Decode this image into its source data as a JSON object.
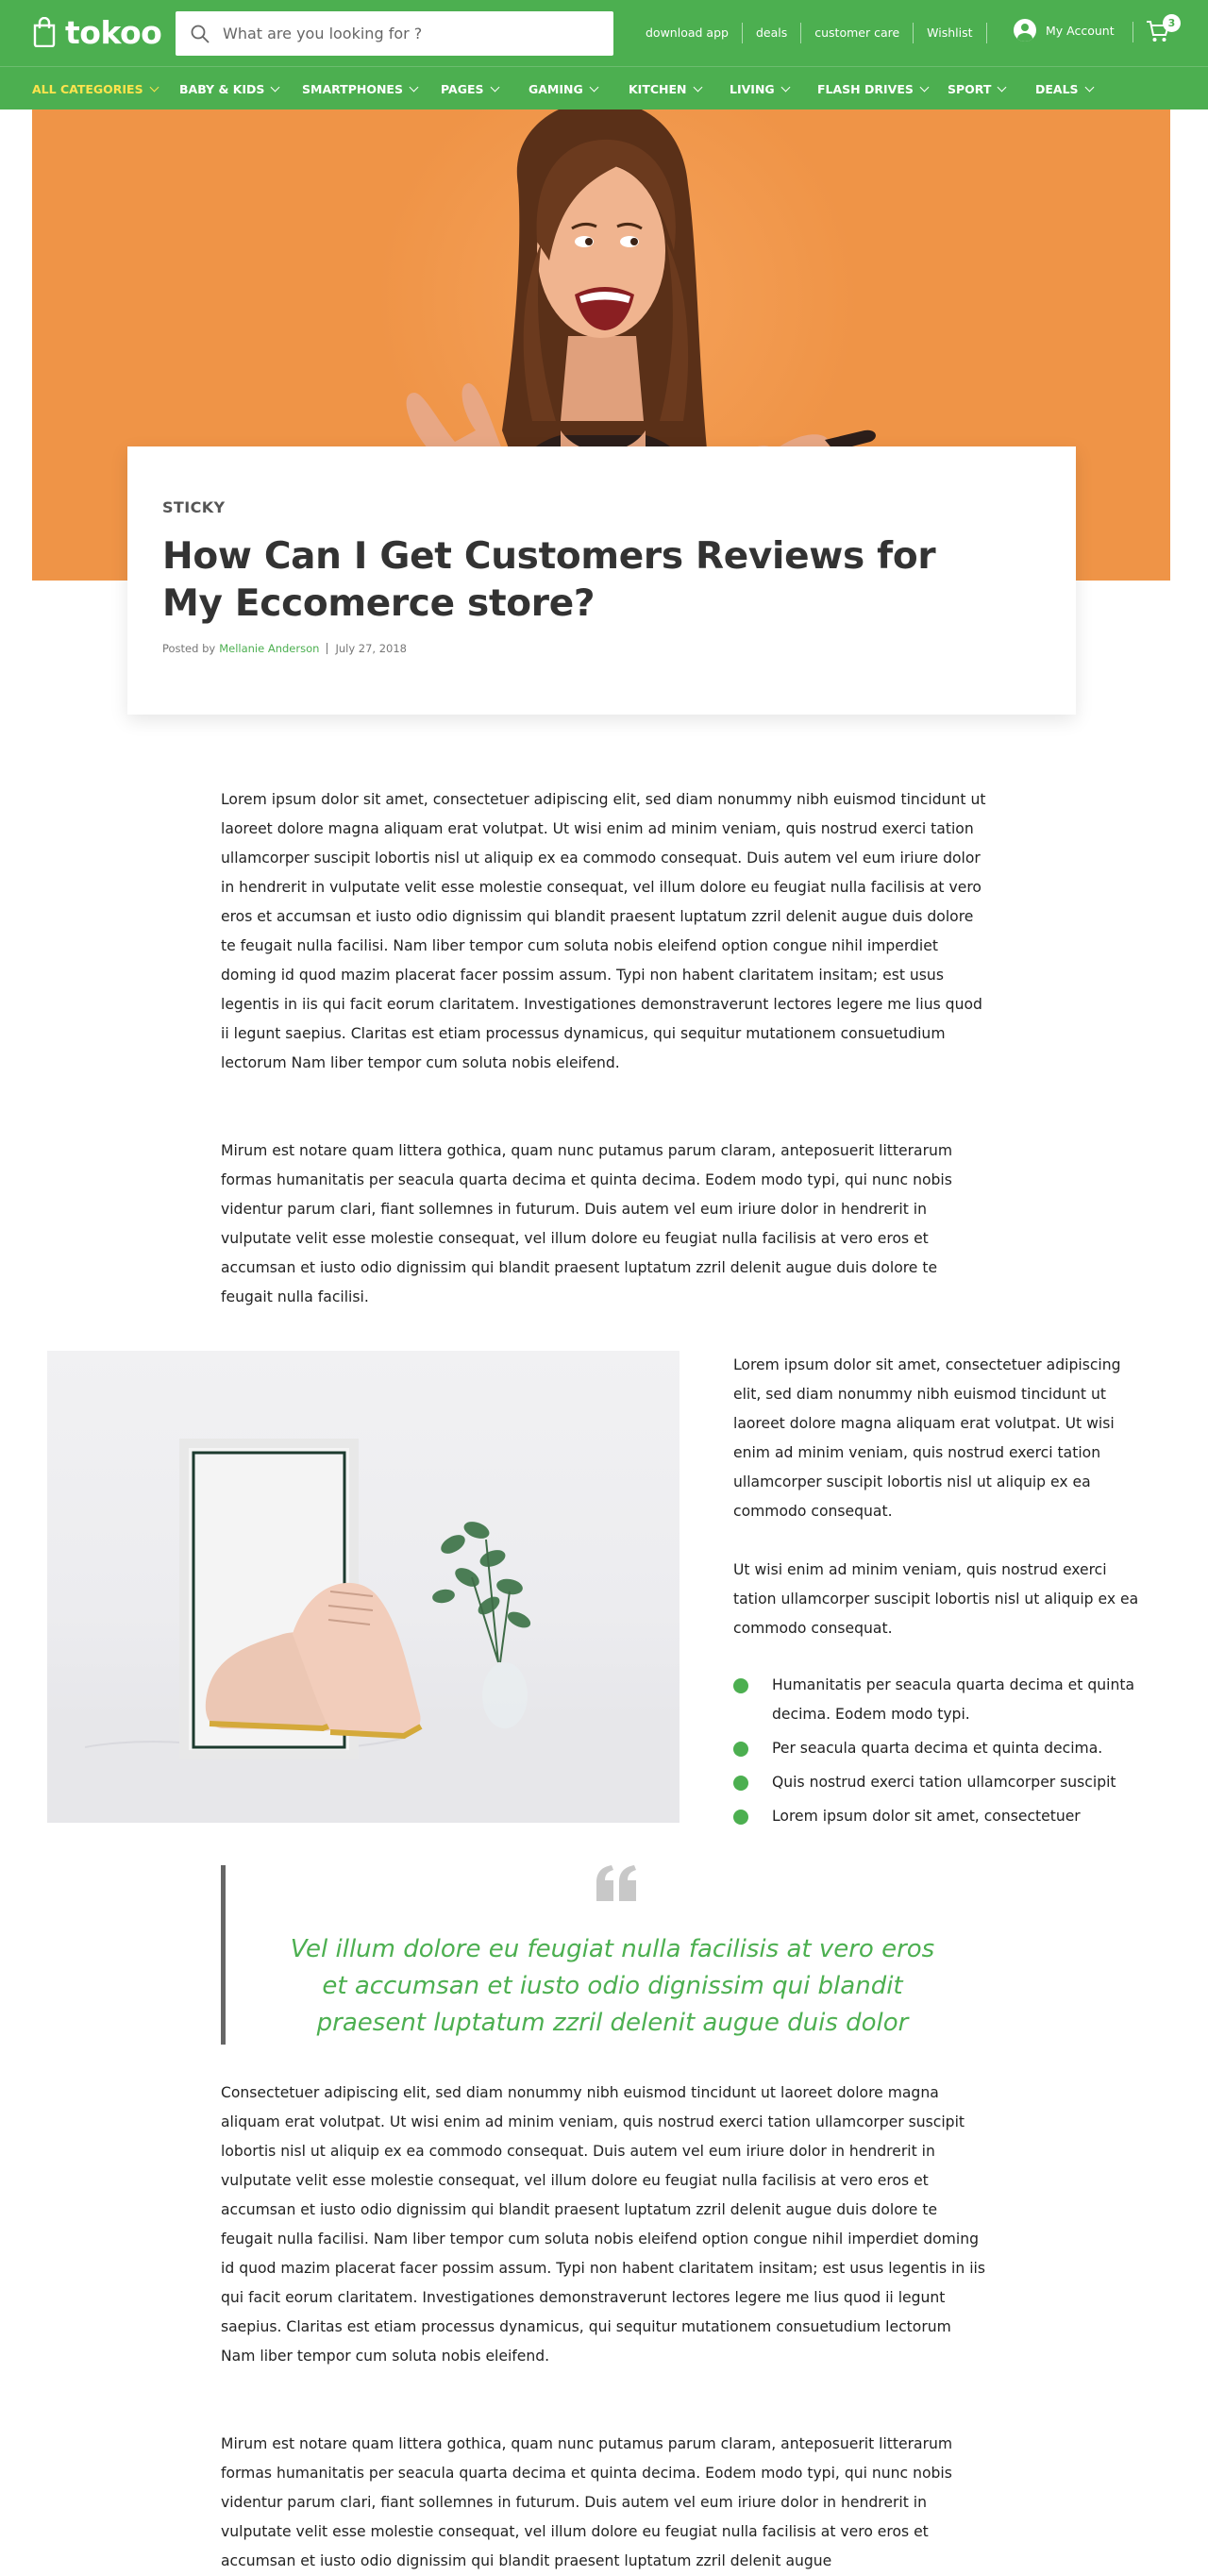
{
  "brand": {
    "name": "tokoo",
    "accent": "#4caf50",
    "nav_active": "#ffe44d",
    "hero_bg": "#ef9447"
  },
  "search": {
    "placeholder": "What are you looking for ?"
  },
  "top_links": [
    "download app",
    "deals",
    "customer care",
    "Wishlist"
  ],
  "account": {
    "label": "My Account",
    "icon": "user-icon"
  },
  "cart": {
    "count": "3",
    "icon": "cart-icon"
  },
  "nav": [
    {
      "label": "ALL CATEGORIES",
      "active": true
    },
    {
      "label": "BABY & KIDS"
    },
    {
      "label": "SMARTPHONES"
    },
    {
      "label": "PAGES"
    },
    {
      "label": "GAMING"
    },
    {
      "label": "KITCHEN"
    },
    {
      "label": "LIVING"
    },
    {
      "label": "FLASH DRIVES"
    },
    {
      "label": "SPORT"
    },
    {
      "label": "DEALS"
    }
  ],
  "post": {
    "tag": "STICKY",
    "title": "How Can I Get Customers Reviews for My Eccomerce store?",
    "posted_by": "Posted by",
    "author": "Mellanie Anderson",
    "date": "July 27, 2018"
  },
  "content": {
    "p1": "Lorem ipsum dolor sit amet, consectetuer adipiscing elit, sed diam nonummy nibh euismod tincidunt ut laoreet dolore magna aliquam erat volutpat. Ut wisi enim ad minim veniam, quis nostrud exerci tation ullamcorper suscipit lobortis nisl ut aliquip ex ea commodo consequat. Duis autem vel eum iriure dolor in hendrerit in vulputate velit esse molestie consequat, vel illum dolore eu feugiat nulla facilisis at vero eros et accumsan et iusto odio dignissim qui blandit praesent luptatum zzril delenit augue duis dolore te feugait nulla facilisi. Nam liber tempor cum soluta nobis eleifend option congue nihil imperdiet doming id quod mazim placerat facer possim assum. Typi non habent claritatem insitam; est usus legentis in iis qui facit eorum claritatem. Investigationes demonstraverunt lectores legere me lius quod ii legunt saepius. Claritas est etiam processus dynamicus, qui sequitur mutationem consuetudium lectorum Nam liber tempor cum soluta nobis eleifend.",
    "p2": "Mirum est notare quam littera gothica, quam nunc putamus parum claram, anteposuerit litterarum formas humanitatis per seacula quarta decima et quinta decima. Eodem modo typi, qui nunc nobis videntur parum clari, fiant sollemnes in futurum. Duis autem vel eum iriure dolor in hendrerit in vulputate velit esse molestie consequat, vel illum dolore eu feugiat nulla facilisis at vero eros et accumsan et iusto odio dignissim qui blandit praesent luptatum zzril delenit augue duis dolore te feugait nulla facilisi.",
    "side1": "Lorem ipsum dolor sit amet, consectetuer adipiscing elit, sed diam nonummy nibh euismod tincidunt ut laoreet dolore magna aliquam erat volutpat. Ut wisi enim ad minim veniam, quis nostrud exerci tation ullamcorper suscipit lobortis nisl ut aliquip ex ea commodo consequat.",
    "side2": "Ut wisi enim ad minim veniam, quis nostrud exerci tation ullamcorper suscipit lobortis nisl ut aliquip ex ea commodo consequat.",
    "bullets": [
      "Humanitatis per seacula quarta decima et quinta decima. Eodem modo typi.",
      "Per seacula quarta decima et quinta decima.",
      "Quis nostrud exerci tation ullamcorper suscipit",
      "Lorem ipsum dolor sit amet, consectetuer"
    ],
    "quote": "Vel illum dolore eu feugiat nulla facilisis at vero eros et accumsan et iusto odio dignissim qui blandit praesent luptatum zzril delenit augue duis dolor",
    "p3": "Consectetuer adipiscing elit, sed diam nonummy nibh euismod tincidunt ut laoreet dolore magna aliquam erat volutpat. Ut wisi enim ad minim veniam, quis nostrud exerci tation ullamcorper suscipit lobortis nisl ut aliquip ex ea commodo consequat. Duis autem vel eum iriure dolor in hendrerit in vulputate velit esse molestie consequat, vel illum dolore eu feugiat nulla facilisis at vero eros et accumsan et iusto odio dignissim qui blandit praesent luptatum zzril delenit augue duis dolore te feugait nulla facilisi. Nam liber tempor cum soluta nobis eleifend option congue nihil imperdiet doming id quod mazim placerat facer possim assum. Typi non habent claritatem insitam; est usus legentis in iis qui facit eorum claritatem. Investigationes demonstraverunt lectores legere me lius quod ii legunt saepius. Claritas est etiam processus dynamicus, qui sequitur mutationem consuetudium lectorum Nam liber tempor cum soluta nobis eleifend.",
    "p4": "Mirum est notare quam littera gothica, quam nunc putamus parum claram, anteposuerit litterarum formas humanitatis per seacula quarta decima et quinta decima. Eodem modo typi, qui nunc nobis videntur parum clari, fiant sollemnes in futurum. Duis autem vel eum iriure dolor in hendrerit in vulputate velit esse molestie consequat, vel illum dolore eu feugiat nulla facilisis at vero eros et accumsan et iusto odio dignissim qui blandit praesent luptatum zzril delenit augue"
  }
}
